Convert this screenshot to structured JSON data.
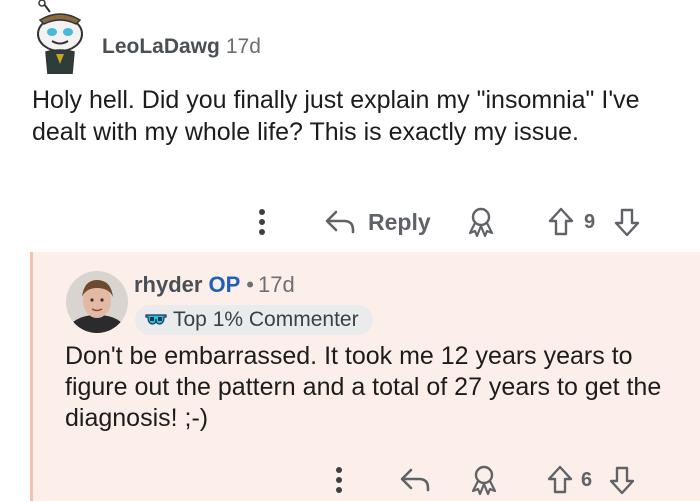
{
  "parent_comment": {
    "username": "LeoLaDawg",
    "age": "17d",
    "body": "Holy hell. Did you finally just explain my \"insomnia\" I've dealt with my whole life? This is exactly my issue.",
    "actions": {
      "reply_label": "Reply",
      "vote_count": "9"
    }
  },
  "reply_comment": {
    "username": "rhyder",
    "op_badge": "OP",
    "separator": "•",
    "age": "17d",
    "flair": "Top 1% Commenter",
    "body": "Don't be embarrassed. It took me 12 years years to figure out the pattern and a total of 27 years to get the diagnosis! ;-)",
    "actions": {
      "vote_count": "6"
    }
  },
  "colors": {
    "reply_background": "#fcefe9",
    "reply_border": "#f3c2ab",
    "op_badge": "#1e5fb8",
    "icon_gray": "#5f6368"
  },
  "icons": {
    "more": "more-options-icon",
    "reply": "reply-arrow-icon",
    "award": "award-icon",
    "upvote": "upvote-arrow-icon",
    "downvote": "downvote-arrow-icon",
    "flair": "sunglasses-icon"
  }
}
